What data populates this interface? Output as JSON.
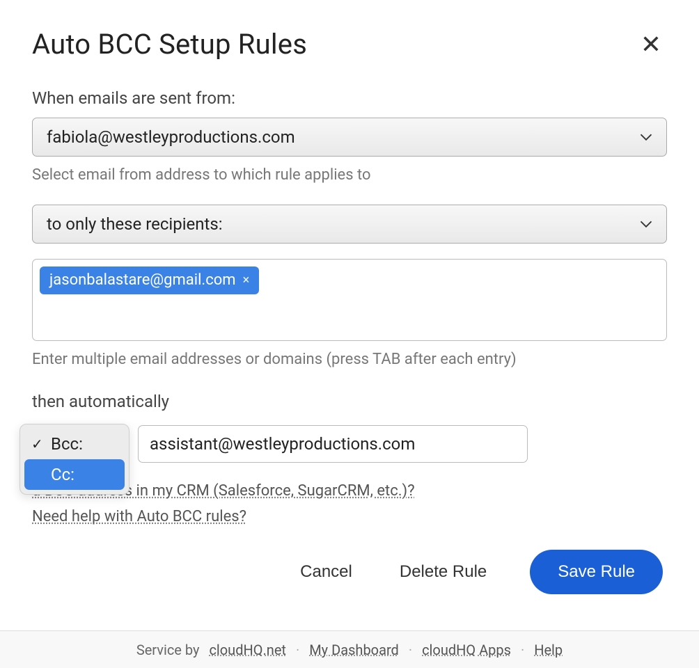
{
  "title": "Auto BCC Setup Rules",
  "from_label": "When emails are sent from:",
  "from_select": {
    "value": "fabiola@westleyproductions.com"
  },
  "from_helper": "Select email from address to which rule applies to",
  "recipients_select": {
    "value": "to only these recipients:"
  },
  "recipients_chips": [
    {
      "email": "jasonbalastare@gmail.com"
    }
  ],
  "recipients_helper": "Enter multiple email addresses or domains (press TAB after each entry)",
  "action_label": "then automatically",
  "bcccc_dropdown": {
    "options": [
      {
        "label": "Bcc:",
        "selected": true,
        "highlight": false
      },
      {
        "label": "Cc:",
        "selected": false,
        "highlight": true
      }
    ]
  },
  "target_email": "assistant@westleyproductions.com",
  "help_links": {
    "crm_partial": "d BCC address in my CRM (Salesforce, SugarCRM, etc.)?",
    "rules": "Need help with Auto BCC rules?"
  },
  "buttons": {
    "cancel": "Cancel",
    "delete": "Delete Rule",
    "save": "Save Rule"
  },
  "footer": {
    "service_prefix": "Service by ",
    "service_link": "cloudHQ.net",
    "dashboard": "My Dashboard",
    "apps": "cloudHQ Apps",
    "help": "Help"
  }
}
